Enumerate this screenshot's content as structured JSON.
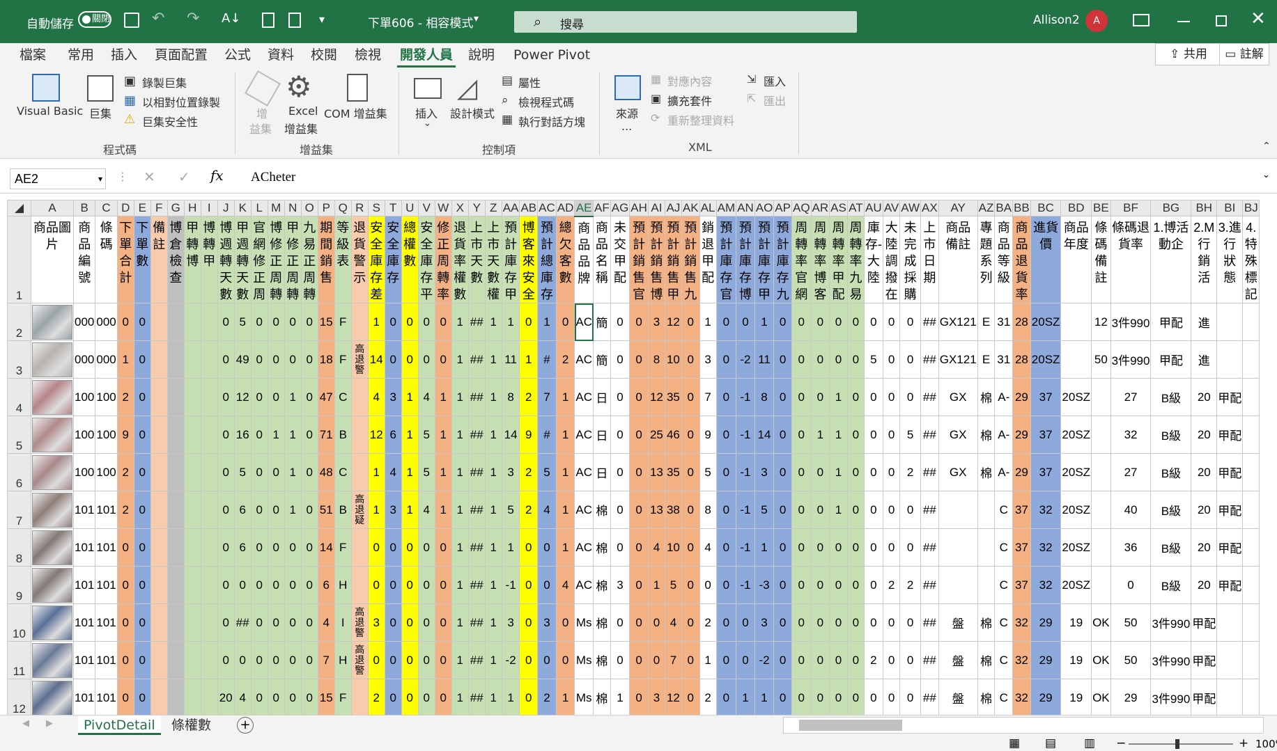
{
  "title_bar": {
    "autosave": "自動儲存",
    "toggle": "關閉",
    "doc_title": "下單606 - 相容模式",
    "search": "搜尋",
    "user": "Allison2",
    "avatar": "A"
  },
  "menu": {
    "tabs": [
      "檔案",
      "常用",
      "插入",
      "頁面配置",
      "公式",
      "資料",
      "校閱",
      "檢視",
      "開發人員",
      "說明",
      "Power Pivot"
    ],
    "active": "開發人員",
    "share": "共用",
    "comment": "註解"
  },
  "ribbon": {
    "code": {
      "vb": "Visual Basic",
      "macro": "巨集",
      "record": "錄製巨集",
      "relative": "以相對位置錄製",
      "security": "巨集安全性",
      "group": "程式碼"
    },
    "addins": {
      "addin_1": "增",
      "addin_2": "益集",
      "excel_1": "Excel",
      "excel_2": "增益集",
      "com": "COM 增益集",
      "group": "增益集"
    },
    "controls": {
      "insert": "插入",
      "design": "設計模式",
      "props": "屬性",
      "view_code": "檢視程式碼",
      "dialog": "執行對話方塊",
      "group": "控制項"
    },
    "xml": {
      "source_1": "來源",
      "source_2": "...",
      "map": "對應內容",
      "expansion": "擴充套件",
      "refresh": "重新整理資料",
      "import": "匯入",
      "export": "匯出",
      "group": "XML"
    }
  },
  "formula_bar": {
    "name_box": "AE2",
    "formula": "ACheter"
  },
  "colors": {
    "orange": "#f4b183",
    "blue": "#8ea9db",
    "green": "#c6e0b4",
    "yellow": "#ffff00",
    "gray": "#bfbfbf",
    "peach": "#f8cbad",
    "white": "#ffffff"
  },
  "columns": [
    {
      "l": "A",
      "h": "商品圖片",
      "w": 60,
      "c": "white"
    },
    {
      "l": "B",
      "h": "商品編號",
      "w": 24,
      "c": "white"
    },
    {
      "l": "C",
      "h": "條碼",
      "w": 24,
      "c": "white"
    },
    {
      "l": "D",
      "h": "下單合計",
      "w": 24,
      "c": "orange"
    },
    {
      "l": "E",
      "h": "下單數",
      "w": 24,
      "c": "blue"
    },
    {
      "l": "F",
      "h": "備註",
      "w": 24,
      "c": "peach"
    },
    {
      "l": "G",
      "h": "博倉檢查",
      "w": 24,
      "c": "gray"
    },
    {
      "l": "H",
      "h": "甲轉博",
      "w": 24,
      "c": "green"
    },
    {
      "l": "I",
      "h": "博轉甲",
      "w": 24,
      "c": "green"
    },
    {
      "l": "J",
      "h": "博週轉天數",
      "w": 24,
      "c": "green"
    },
    {
      "l": "K",
      "h": "甲週轉天數",
      "w": 24,
      "c": "green"
    },
    {
      "l": "L",
      "h": "官網修正周",
      "w": 24,
      "c": "green"
    },
    {
      "l": "M",
      "h": "博修正周轉",
      "w": 24,
      "c": "green"
    },
    {
      "l": "N",
      "h": "甲修正周轉",
      "w": 24,
      "c": "green"
    },
    {
      "l": "O",
      "h": "九易正周轉",
      "w": 24,
      "c": "green"
    },
    {
      "l": "P",
      "h": "期間銷售",
      "w": 24,
      "c": "orange"
    },
    {
      "l": "Q",
      "h": "等級表",
      "w": 24,
      "c": "green"
    },
    {
      "l": "R",
      "h": "退貨警示",
      "w": 24,
      "c": "peach"
    },
    {
      "l": "S",
      "h": "安全庫存差",
      "w": 24,
      "c": "yellow"
    },
    {
      "l": "T",
      "h": "安全庫存",
      "w": 24,
      "c": "blue"
    },
    {
      "l": "U",
      "h": "總權數",
      "w": 24,
      "c": "yellow"
    },
    {
      "l": "V",
      "h": "安全庫存平",
      "w": 24,
      "c": "green"
    },
    {
      "l": "W",
      "h": "修正周轉率",
      "w": 24,
      "c": "orange"
    },
    {
      "l": "X",
      "h": "退貨率權數",
      "w": 24,
      "c": "green"
    },
    {
      "l": "Y",
      "h": "上市天數",
      "w": 24,
      "c": "green"
    },
    {
      "l": "Z",
      "h": "上市天數權",
      "w": 24,
      "c": "green"
    },
    {
      "l": "AA",
      "h": "預計庫存甲",
      "w": 24,
      "c": "green"
    },
    {
      "l": "AB",
      "h": "博客來安全",
      "w": 24,
      "c": "yellow"
    },
    {
      "l": "AC",
      "h": "預計總庫存",
      "w": 24,
      "c": "blue"
    },
    {
      "l": "AD",
      "h": "總欠客數",
      "w": 24,
      "c": "orange"
    },
    {
      "l": "AE",
      "h": "商品品牌",
      "w": 24,
      "c": "white"
    },
    {
      "l": "AF",
      "h": "商品名稱",
      "w": 24,
      "c": "white"
    },
    {
      "l": "AG",
      "h": "未交甲配",
      "w": 24,
      "c": "white"
    },
    {
      "l": "AH",
      "h": "預計銷售官",
      "w": 24,
      "c": "orange"
    },
    {
      "l": "AI",
      "h": "預計銷售博",
      "w": 24,
      "c": "orange"
    },
    {
      "l": "AJ",
      "h": "預計銷售甲",
      "w": 24,
      "c": "orange"
    },
    {
      "l": "AK",
      "h": "預計銷售九",
      "w": 24,
      "c": "orange"
    },
    {
      "l": "AL",
      "h": "銷退甲配",
      "w": 24,
      "c": "white"
    },
    {
      "l": "AM",
      "h": "預計庫存官",
      "w": 24,
      "c": "blue"
    },
    {
      "l": "AN",
      "h": "預計庫存博",
      "w": 24,
      "c": "blue"
    },
    {
      "l": "AO",
      "h": "預計庫存甲",
      "w": 24,
      "c": "blue"
    },
    {
      "l": "AP",
      "h": "預計庫存九",
      "w": 24,
      "c": "blue"
    },
    {
      "l": "AQ",
      "h": "周轉率官網",
      "w": 24,
      "c": "green"
    },
    {
      "l": "AR",
      "h": "周轉率博客",
      "w": 24,
      "c": "green"
    },
    {
      "l": "AS",
      "h": "周轉率甲配",
      "w": 24,
      "c": "green"
    },
    {
      "l": "AT",
      "h": "周轉率九易",
      "w": 24,
      "c": "green"
    },
    {
      "l": "AU",
      "h": "庫存-大陸",
      "w": 24,
      "c": "white"
    },
    {
      "l": "AV",
      "h": "大陸調撥在",
      "w": 24,
      "c": "white"
    },
    {
      "l": "AW",
      "h": "未完成採購",
      "w": 24,
      "c": "white"
    },
    {
      "l": "AX",
      "h": "上市日期",
      "w": 24,
      "c": "white"
    },
    {
      "l": "AY",
      "h": "商品備註",
      "w": 24,
      "c": "white"
    },
    {
      "l": "AZ",
      "h": "專題系列",
      "w": 24,
      "c": "white"
    },
    {
      "l": "BA",
      "h": "商品等級",
      "w": 24,
      "c": "white"
    },
    {
      "l": "BB",
      "h": "商品退貨率",
      "w": 24,
      "c": "orange"
    },
    {
      "l": "BC",
      "h": "進貨價",
      "w": 24,
      "c": "blue"
    },
    {
      "l": "BD",
      "h": "商品年度",
      "w": 24,
      "c": "white"
    },
    {
      "l": "BE",
      "h": "條碼備註",
      "w": 24,
      "c": "white"
    },
    {
      "l": "BF",
      "h": "條碼退貨率",
      "w": 24,
      "c": "white"
    },
    {
      "l": "BG",
      "h": "1.博活動企",
      "w": 24,
      "c": "white"
    },
    {
      "l": "BH",
      "h": "2.M行銷活",
      "w": 24,
      "c": "white"
    },
    {
      "l": "BI",
      "h": "3.進行狀態",
      "w": 24,
      "c": "white"
    },
    {
      "l": "BJ",
      "h": "4.特殊標記",
      "w": 24,
      "c": "white"
    }
  ],
  "rows": [
    {
      "n": "2",
      "pic": "#9aa3a8",
      "v": [
        "",
        "000",
        "000",
        "0",
        "0",
        "",
        "",
        "",
        "",
        "0",
        "5",
        "0",
        "0",
        "0",
        "0",
        "15",
        "F",
        "",
        "1",
        "0",
        "0",
        "0",
        "0",
        "1",
        "##",
        "1",
        "1",
        "0",
        "1",
        "0",
        "AC",
        "簡",
        "0",
        "0",
        "3",
        "12",
        "0",
        "1",
        "0",
        "0",
        "1",
        "0",
        "0",
        "0",
        "0",
        "0",
        "0",
        "0",
        "0",
        "##",
        "GX121",
        "E",
        "31",
        "28",
        "20SZ",
        "",
        "12",
        "3件990",
        "甲配",
        "進"
      ]
    },
    {
      "n": "3",
      "pic": "#b7b3ad",
      "v": [
        "",
        "000",
        "000",
        "1",
        "0",
        "",
        "",
        "",
        "",
        "0",
        "49",
        "0",
        "0",
        "0",
        "0",
        "18",
        "F",
        "高退警",
        "14",
        "0",
        "0",
        "0",
        "0",
        "1",
        "##",
        "1",
        "11",
        "1",
        "#",
        "2",
        "AC",
        "簡",
        "0",
        "0",
        "8",
        "10",
        "0",
        "3",
        "0",
        "-2",
        "11",
        "0",
        "0",
        "0",
        "0",
        "0",
        "5",
        "0",
        "0",
        "##",
        "GX121",
        "E",
        "31",
        "28",
        "20SZ",
        "",
        "50",
        "3件990",
        "甲配",
        "進"
      ]
    },
    {
      "n": "4",
      "pic": "#b6868a",
      "v": [
        "",
        "100",
        "100",
        "2",
        "0",
        "",
        "",
        "",
        "",
        "0",
        "12",
        "0",
        "0",
        "1",
        "0",
        "47",
        "C",
        "",
        "4",
        "3",
        "1",
        "4",
        "1",
        "1",
        "##",
        "1",
        "8",
        "2",
        "7",
        "1",
        "AC",
        "日",
        "0",
        "0",
        "12",
        "35",
        "0",
        "7",
        "0",
        "-1",
        "8",
        "0",
        "0",
        "0",
        "1",
        "0",
        "0",
        "0",
        "0",
        "##",
        "GX",
        "棉",
        "A-",
        "29",
        "37",
        "20SZ",
        "",
        "27",
        "B級",
        "20",
        "甲配"
      ]
    },
    {
      "n": "5",
      "pic": "#b08a8b",
      "v": [
        "",
        "100",
        "100",
        "9",
        "0",
        "",
        "",
        "",
        "",
        "0",
        "16",
        "0",
        "1",
        "1",
        "0",
        "71",
        "B",
        "",
        "12",
        "6",
        "1",
        "5",
        "1",
        "1",
        "##",
        "1",
        "14",
        "9",
        "#",
        "1",
        "AC",
        "日",
        "0",
        "0",
        "25",
        "46",
        "0",
        "9",
        "0",
        "-1",
        "14",
        "0",
        "0",
        "1",
        "1",
        "0",
        "0",
        "0",
        "5",
        "##",
        "GX",
        "棉",
        "A-",
        "29",
        "37",
        "20SZ",
        "",
        "32",
        "B級",
        "20",
        "甲配"
      ]
    },
    {
      "n": "6",
      "pic": "#a9888a",
      "v": [
        "",
        "100",
        "100",
        "2",
        "0",
        "",
        "",
        "",
        "",
        "0",
        "5",
        "0",
        "0",
        "1",
        "0",
        "48",
        "C",
        "",
        "1",
        "4",
        "1",
        "5",
        "1",
        "1",
        "##",
        "1",
        "3",
        "2",
        "5",
        "1",
        "AC",
        "日",
        "0",
        "0",
        "13",
        "35",
        "0",
        "5",
        "0",
        "-1",
        "3",
        "0",
        "0",
        "0",
        "1",
        "0",
        "0",
        "0",
        "2",
        "##",
        "GX",
        "棉",
        "A-",
        "29",
        "37",
        "20SZ",
        "",
        "27",
        "B級",
        "20",
        "甲配"
      ]
    },
    {
      "n": "7",
      "pic": "#8f7f7a",
      "v": [
        "",
        "101",
        "101",
        "2",
        "0",
        "",
        "",
        "",
        "",
        "0",
        "6",
        "0",
        "0",
        "1",
        "0",
        "51",
        "B",
        "高退疑",
        "1",
        "3",
        "1",
        "4",
        "1",
        "1",
        "##",
        "1",
        "5",
        "2",
        "4",
        "1",
        "AC",
        "棉",
        "0",
        "0",
        "13",
        "38",
        "0",
        "8",
        "0",
        "-1",
        "5",
        "0",
        "0",
        "0",
        "1",
        "0",
        "0",
        "0",
        "0",
        "##",
        "",
        "",
        "C",
        "37",
        "32",
        "20SZ",
        "",
        "40",
        "B級",
        "20",
        "甲配"
      ]
    },
    {
      "n": "8",
      "pic": "#857975",
      "v": [
        "",
        "101",
        "101",
        "0",
        "0",
        "",
        "",
        "",
        "",
        "0",
        "6",
        "0",
        "0",
        "0",
        "0",
        "14",
        "F",
        "",
        "0",
        "0",
        "0",
        "0",
        "0",
        "1",
        "##",
        "1",
        "1",
        "0",
        "0",
        "1",
        "AC",
        "棉",
        "0",
        "0",
        "4",
        "10",
        "0",
        "4",
        "0",
        "-1",
        "1",
        "0",
        "0",
        "0",
        "0",
        "0",
        "0",
        "0",
        "0",
        "##",
        "",
        "",
        "C",
        "37",
        "32",
        "20SZ",
        "",
        "36",
        "B級",
        "20",
        "甲配"
      ]
    },
    {
      "n": "9",
      "pic": "#837976",
      "v": [
        "",
        "101",
        "101",
        "0",
        "0",
        "",
        "",
        "",
        "",
        "0",
        "0",
        "0",
        "0",
        "0",
        "0",
        "6",
        "H",
        "",
        "0",
        "0",
        "0",
        "0",
        "0",
        "1",
        "##",
        "1",
        "-1",
        "0",
        "0",
        "4",
        "AC",
        "棉",
        "3",
        "0",
        "1",
        "5",
        "0",
        "0",
        "0",
        "-1",
        "-3",
        "0",
        "0",
        "0",
        "0",
        "0",
        "0",
        "2",
        "2",
        "##",
        "",
        "",
        "C",
        "37",
        "32",
        "20SZ",
        "",
        "0",
        "B級",
        "20",
        "甲配"
      ]
    },
    {
      "n": "10",
      "pic": "#5a6f98",
      "v": [
        "",
        "101",
        "101",
        "0",
        "0",
        "",
        "",
        "",
        "",
        "0",
        "##",
        "0",
        "0",
        "0",
        "0",
        "4",
        "I",
        "高退警",
        "3",
        "0",
        "0",
        "0",
        "0",
        "1",
        "##",
        "1",
        "3",
        "0",
        "3",
        "0",
        "Ms",
        "棉",
        "0",
        "0",
        "0",
        "4",
        "0",
        "2",
        "0",
        "0",
        "3",
        "0",
        "0",
        "0",
        "0",
        "0",
        "0",
        "0",
        "0",
        "##",
        "盤",
        "棉",
        "C",
        "32",
        "29",
        "19",
        "OK",
        "50",
        "3件990",
        "甲配"
      ]
    },
    {
      "n": "11",
      "pic": "#6b7a98",
      "v": [
        "",
        "101",
        "101",
        "0",
        "0",
        "",
        "",
        "",
        "",
        "0",
        "0",
        "0",
        "0",
        "0",
        "0",
        "7",
        "H",
        "高退警",
        "0",
        "0",
        "0",
        "0",
        "0",
        "1",
        "##",
        "1",
        "-2",
        "0",
        "0",
        "0",
        "Ms",
        "棉",
        "0",
        "0",
        "0",
        "7",
        "0",
        "1",
        "0",
        "0",
        "-2",
        "0",
        "0",
        "0",
        "0",
        "0",
        "2",
        "0",
        "0",
        "##",
        "盤",
        "棉",
        "C",
        "32",
        "29",
        "19",
        "OK",
        "50",
        "3件990",
        "甲配"
      ]
    },
    {
      "n": "12",
      "pic": "#5d6e8f",
      "v": [
        "",
        "101",
        "101",
        "0",
        "0",
        "",
        "",
        "",
        "",
        "20",
        "4",
        "0",
        "0",
        "0",
        "0",
        "15",
        "F",
        "",
        "2",
        "0",
        "0",
        "0",
        "0",
        "1",
        "##",
        "1",
        "1",
        "0",
        "2",
        "1",
        "Ms",
        "棉",
        "1",
        "0",
        "3",
        "12",
        "0",
        "2",
        "0",
        "1",
        "1",
        "0",
        "0",
        "0",
        "0",
        "0",
        "0",
        "0",
        "0",
        "##",
        "盤",
        "棉",
        "C",
        "32",
        "29",
        "19",
        "OK",
        "29",
        "3件990",
        "甲配"
      ]
    }
  ],
  "sheets": {
    "active": "PivotDetail",
    "other": "條權數"
  },
  "status": {
    "zoom": "100%"
  }
}
